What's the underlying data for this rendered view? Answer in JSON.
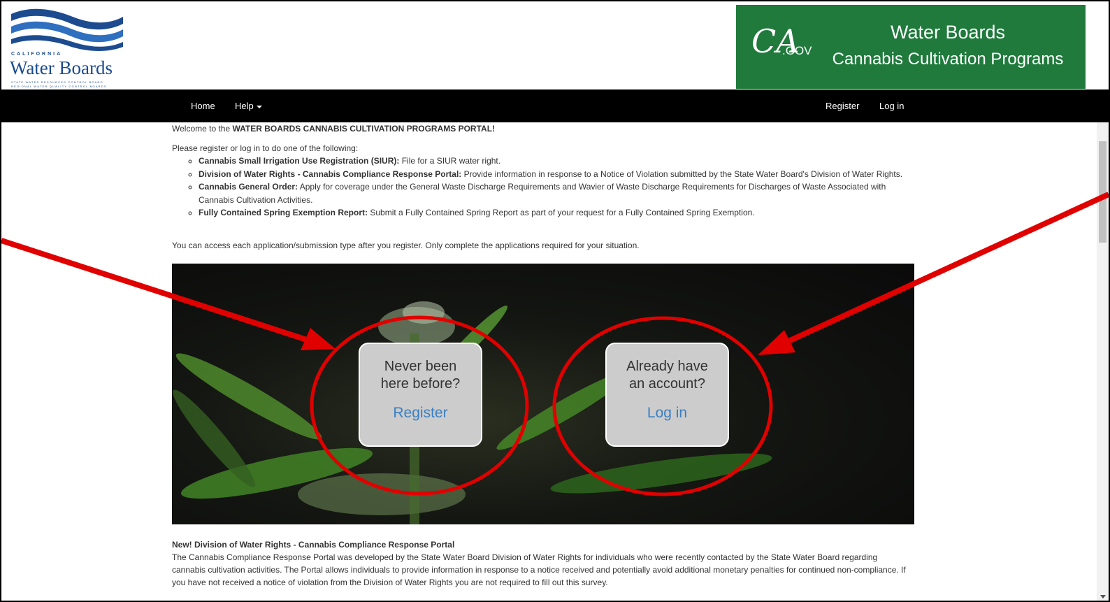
{
  "header": {
    "logo": {
      "state": "CALIFORNIA",
      "title": "Water Boards",
      "sub1": "STATE WATER RESOURCES CONTROL BOARD",
      "sub2": "REGIONAL WATER QUALITY CONTROL BOARDS"
    },
    "banner": {
      "ca_mark": "CA",
      "gov_mark": ".GOV",
      "title1": "Water Boards",
      "title2": "Cannabis Cultivation Programs",
      "color": "#1f7a3c"
    }
  },
  "nav": {
    "home": "Home",
    "help": "Help",
    "register": "Register",
    "login": "Log in"
  },
  "content": {
    "welcome_prefix": "Welcome to the ",
    "welcome_strong": "WATER BOARDS CANNABIS CULTIVATION PROGRAMS PORTAL!",
    "intro": "Please register or log in to do one of the following:",
    "applications": [
      {
        "title": "Cannabis Small Irrigation Use Registration (SIUR):",
        "desc": " File for a SIUR water right."
      },
      {
        "title": "Division of Water Rights - Cannabis Compliance Response Portal:",
        "desc": " Provide information in response to a Notice of Violation submitted by the State Water Board's Division of Water Rights."
      },
      {
        "title": "Cannabis General Order:",
        "desc": " Apply for coverage under the General Waste Discharge Requirements and Wavier of Waste Discharge Requirements for Discharges of Waste Associated with Cannabis Cultivation Activities."
      },
      {
        "title": "Fully Contained Spring Exemption Report:",
        "desc": " Submit a Fully Contained Spring Report as part of your request for a Fully Contained Spring Exemption."
      }
    ],
    "access_note": "You can access each application/submission type after you register. Only complete the applications required for your situation."
  },
  "hero": {
    "new_user": {
      "question_line1": "Never been",
      "question_line2": "here before?",
      "link": "Register"
    },
    "existing_user": {
      "question_line1": "Already have",
      "question_line2": "an account?",
      "link": "Log in"
    },
    "link_color": "#3a7fc1",
    "annotation_color": "#e00000"
  },
  "news": {
    "title": "New! Division of Water Rights - Cannabis Compliance Response Portal",
    "body": "The Cannabis Compliance Response Portal was developed by the State Water Board Division of Water Rights for individuals who were recently contacted by the State Water Board regarding cannabis cultivation activities. The Portal allows individuals to provide information in response to a notice received and potentially avoid additional monetary penalties for continued non-compliance. If you have not received a notice of violation from the Division of Water Rights you are not required to fill out this survey."
  }
}
